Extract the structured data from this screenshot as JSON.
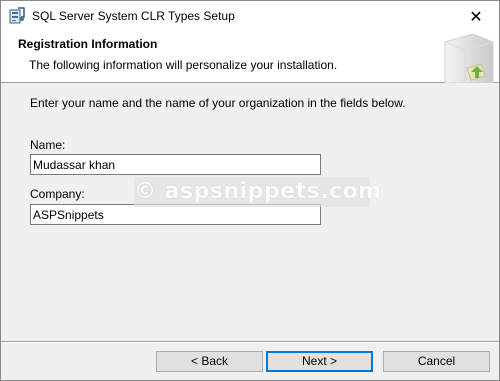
{
  "window": {
    "title": "SQL Server System CLR Types Setup",
    "close_glyph": "✕",
    "icon": "setup-app-icon"
  },
  "banner": {
    "title": "Registration Information",
    "subtitle": "The following information will personalize your installation.",
    "graphic": "server-box-graphic"
  },
  "body": {
    "instruction": "Enter your name and the name of your organization in the fields below."
  },
  "form": {
    "name_label": "Name:",
    "name_value": "Mudassar khan",
    "company_label": "Company:",
    "company_value": "ASPSnippets"
  },
  "watermark": {
    "text": "© aspsnippets.com"
  },
  "buttons": {
    "back": "< Back",
    "next": "Next >",
    "cancel": "Cancel"
  },
  "colors": {
    "window_bg": "#f0f0f0",
    "banner_bg": "#ffffff",
    "button_bg": "#e1e1e1",
    "focus_border": "#0078d7"
  }
}
